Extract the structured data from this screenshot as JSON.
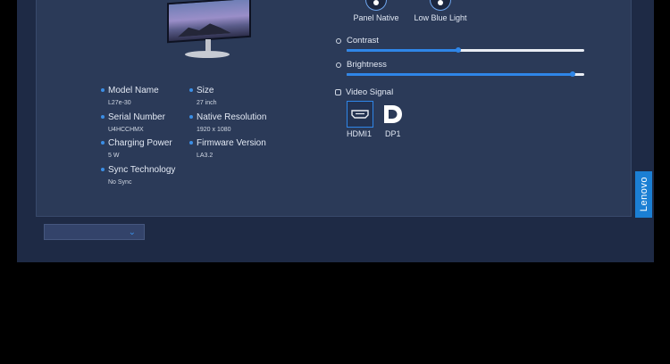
{
  "brand": {
    "logo": "Lenovo"
  },
  "picture_modes": [
    {
      "label": "Panel Native",
      "icon": "panel-native-icon"
    },
    {
      "label": "Low Blue Light",
      "icon": "low-blue-light-icon"
    }
  ],
  "specs": [
    {
      "label": "Model Name",
      "value": "L27e-30"
    },
    {
      "label": "Serial Number",
      "value": "U4HCCHMX"
    },
    {
      "label": "Charging Power",
      "value": "5 W"
    },
    {
      "label": "Sync Technology",
      "value": "No Sync"
    },
    {
      "label": "Size",
      "value": "27 inch"
    },
    {
      "label": "Native Resolution",
      "value": "1920 x 1080"
    },
    {
      "label": "Firmware Version",
      "value": "LA3.2"
    }
  ],
  "sliders": {
    "contrast": {
      "label": "Contrast",
      "value_fraction": 0.47
    },
    "brightness": {
      "label": "Brightness",
      "value_fraction": 0.95
    }
  },
  "video_signal": {
    "title": "Video Signal",
    "inputs": [
      {
        "label": "HDMI1",
        "active": true
      },
      {
        "label": "DP1",
        "active": false
      }
    ]
  },
  "dropdown": {
    "selected": ""
  },
  "colors": {
    "accent": "#2f86e8",
    "panel": "#2b3a58",
    "background": "#1e2a45",
    "brand_tab": "#1b7fd4"
  }
}
